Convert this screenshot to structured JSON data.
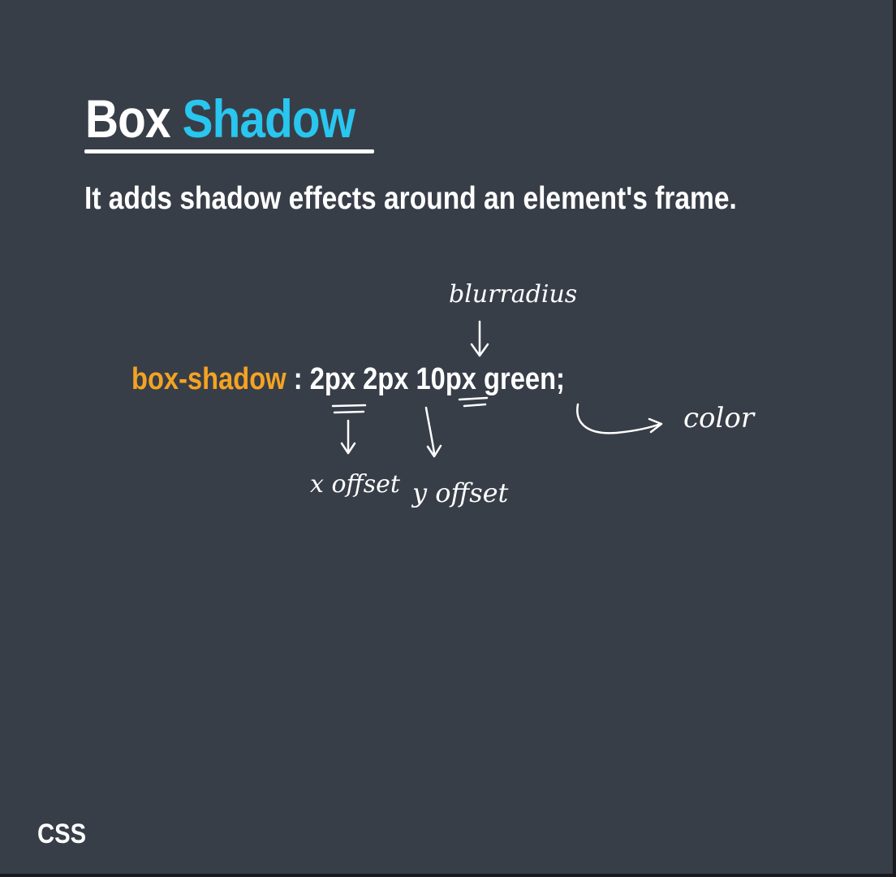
{
  "slide": {
    "title_part1": "Box",
    "title_part2": "Shadow",
    "subtitle": "It adds shadow effects around an element's frame.",
    "code": {
      "property": "box-shadow",
      "separator": " : ",
      "value": "2px 2px 10px green;"
    },
    "corner_label": "CSS"
  },
  "annotations": {
    "blur_note": "blurradius",
    "color_note": "color",
    "x_note": "x offset",
    "y_note": "y offset"
  },
  "colors": {
    "background": "#383e48",
    "title_accent": "#29c6ef",
    "property_accent": "#f4a321",
    "text": "#ffffff"
  }
}
